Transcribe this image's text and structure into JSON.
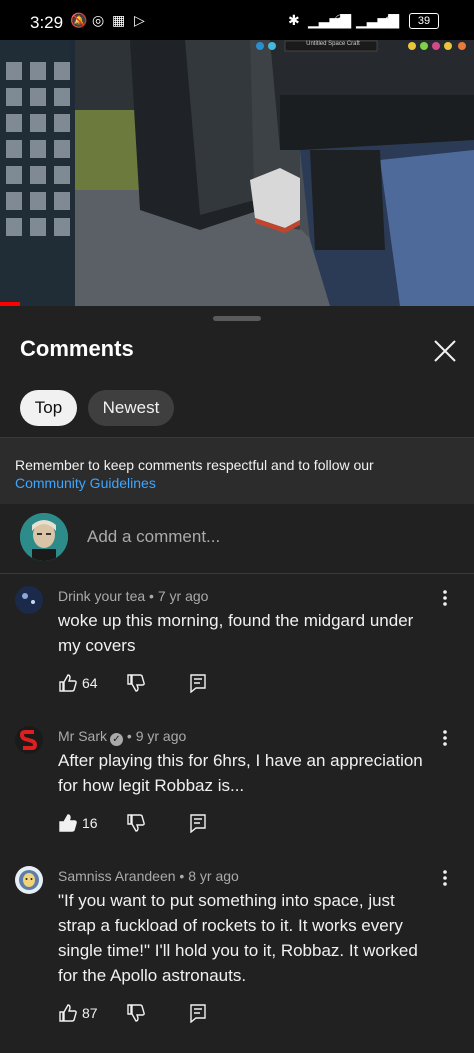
{
  "status_bar": {
    "time": "3:29",
    "battery": "39"
  },
  "video": {
    "overlay_title": "Untitled Space Craft"
  },
  "sheet": {
    "title": "Comments"
  },
  "filters": [
    {
      "label": "Top",
      "selected": true
    },
    {
      "label": "Newest",
      "selected": false
    }
  ],
  "notice": {
    "text": "Remember to keep comments respectful and to follow our",
    "link": "Community Guidelines"
  },
  "add_comment": {
    "placeholder": "Add a comment..."
  },
  "comments": [
    {
      "author": "Drink your tea",
      "age": "7 yr ago",
      "verified": false,
      "text": "woke up this morning, found the midgard under my covers",
      "likes": "64"
    },
    {
      "author": "Mr Sark",
      "age": "9 yr ago",
      "verified": true,
      "text": "After playing this for 6hrs, I have an appreciation for how legit Robbaz is...",
      "likes": "16"
    },
    {
      "author": "Samniss Arandeen",
      "age": "8 yr ago",
      "verified": false,
      "text": "\"If you want to put something into space, just strap a fuckload of rockets to it. It works every single time!\" I'll hold you to it, Robbaz. It worked for the Apollo astronauts.",
      "likes": "87"
    }
  ],
  "colors": {
    "background": "#212121",
    "link": "#3ea6ff",
    "chip_selected": "#f1f1f1",
    "chip": "#3f3f3f"
  }
}
